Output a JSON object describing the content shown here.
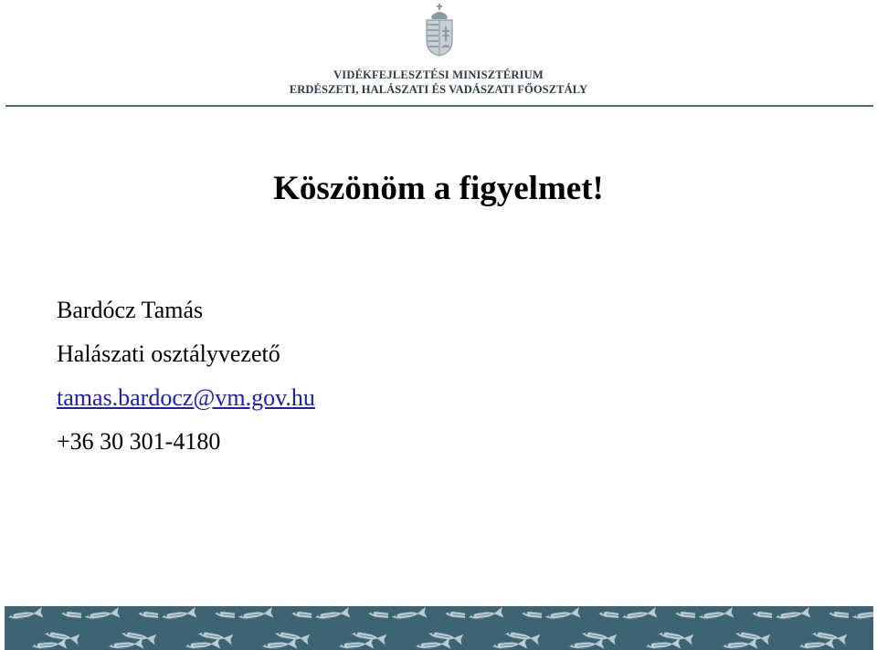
{
  "header": {
    "ministry_line1": "VIDÉKFEJLESZTÉSI MINISZTÉRIUM",
    "ministry_line2": "ERDÉSZETI, HALÁSZATI ÉS VADÁSZATI FŐOSZTÁLY",
    "crest_icon": "hungarian-coat-of-arms-icon"
  },
  "slide": {
    "title": "Köszönöm a figyelmet!"
  },
  "contact": {
    "name": "Bardócz Tamás",
    "position": "Halászati osztályvezető",
    "email": "tamas.bardocz@vm.gov.hu",
    "phone": "+36 30 301-4180"
  },
  "footer": {
    "pattern_icon": "fish-pattern-band",
    "color": "#3b6575"
  }
}
